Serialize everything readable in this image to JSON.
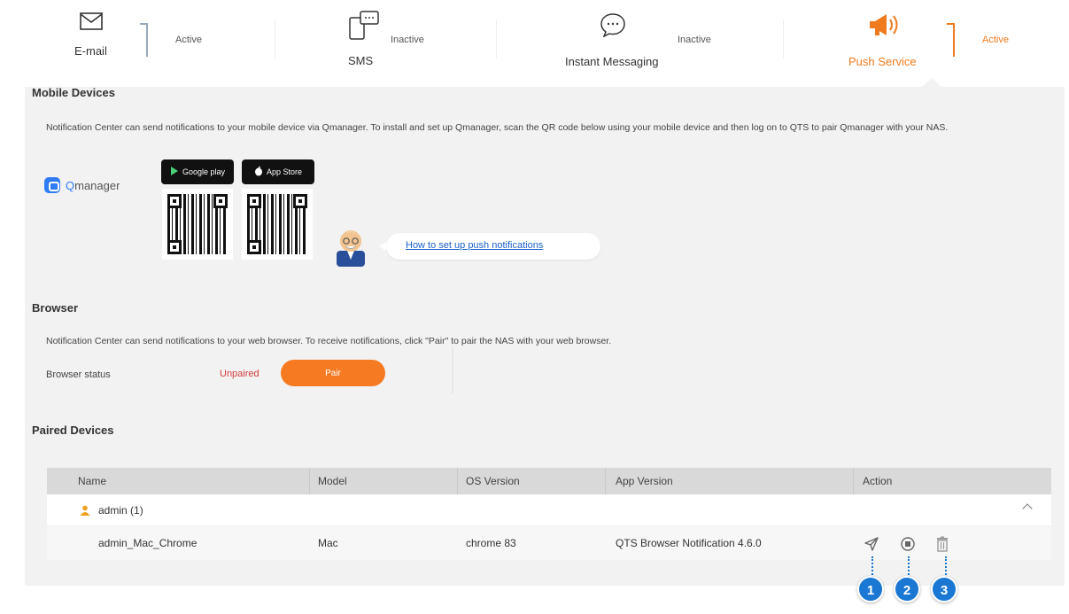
{
  "tabs": [
    {
      "name": "E-mail",
      "status": "Active",
      "icon": "envelope-icon"
    },
    {
      "name": "SMS",
      "status": "Inactive",
      "icon": "sms-phone-icon"
    },
    {
      "name": "Instant Messaging",
      "status": "Inactive",
      "icon": "chat-bubble-icon"
    },
    {
      "name": "Push Service",
      "status": "Active",
      "icon": "megaphone-icon"
    }
  ],
  "colors": {
    "accent": "#f07a1e",
    "link": "#1a5fcc",
    "error": "#d43b3b",
    "callout": "#1a78d4"
  },
  "mobile": {
    "title": "Mobile Devices",
    "description": "Notification Center can send notifications to your mobile device via Qmanager. To install and set up Qmanager, scan the QR code below using your mobile device and then log on to QTS to pair Qmanager with your NAS.",
    "app_name_q": "Q",
    "app_name_rest": "manager",
    "google_play": "Google play",
    "app_store": "App Store",
    "howto_link": "How to set up push notifications"
  },
  "browser": {
    "title": "Browser",
    "description": "Notification Center can send notifications to your web browser. To receive notifications, click \"Pair\" to pair the NAS with your web browser.",
    "status_label": "Browser status",
    "status_value": "Unpaired",
    "pair_button": "Pair"
  },
  "paired": {
    "title": "Paired Devices",
    "columns": [
      "Name",
      "Model",
      "OS Version",
      "App Version",
      "Action"
    ],
    "group": "admin (1)",
    "row": {
      "name": "admin_Mac_Chrome",
      "model": "Mac",
      "os": "chrome 83",
      "app": "QTS Browser Notification 4.6.0"
    }
  },
  "callouts": [
    "1",
    "2",
    "3"
  ]
}
